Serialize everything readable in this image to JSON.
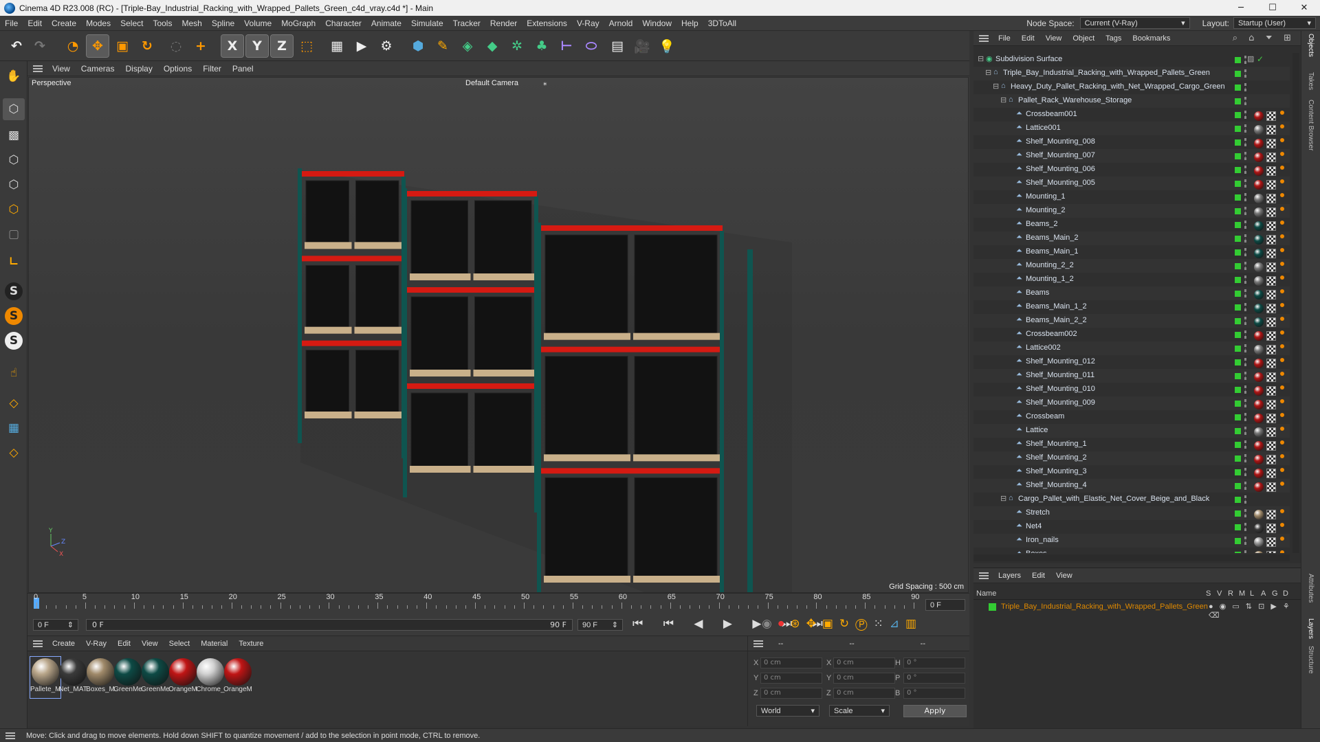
{
  "window": {
    "title": "Cinema 4D R23.008 (RC) - [Triple-Bay_Industrial_Racking_with_Wrapped_Pallets_Green_c4d_vray.c4d *] - Main",
    "min": "─",
    "max": "☐",
    "close": "✕"
  },
  "menu": [
    "File",
    "Edit",
    "Create",
    "Modes",
    "Select",
    "Tools",
    "Mesh",
    "Spline",
    "Volume",
    "MoGraph",
    "Character",
    "Animate",
    "Simulate",
    "Tracker",
    "Render",
    "Extensions",
    "V-Ray",
    "Arnold",
    "Window",
    "Help",
    "3DToAll"
  ],
  "nodespace": {
    "label": "Node Space:",
    "value": "Current (V-Ray)"
  },
  "layout": {
    "label": "Layout:",
    "value": "Startup (User)"
  },
  "toolbar_axes": [
    "X",
    "Y",
    "Z"
  ],
  "viewport": {
    "menu": [
      "View",
      "Cameras",
      "Display",
      "Options",
      "Filter",
      "Panel"
    ],
    "label": "Perspective",
    "camera": "Default Camera",
    "grid": "Grid Spacing : 500 cm",
    "axis_y": "Y",
    "axis_z": "Z",
    "axis_x": "X"
  },
  "timeline": {
    "ticks": [
      "0",
      "5",
      "10",
      "15",
      "20",
      "25",
      "30",
      "35",
      "40",
      "45",
      "50",
      "55",
      "60",
      "65",
      "70",
      "75",
      "80",
      "85",
      "90"
    ],
    "current": "0 F",
    "start": "0 F",
    "range_start": "0 F",
    "range_end": "90 F",
    "end": "90 F"
  },
  "materials": {
    "menu": [
      "Create",
      "V-Ray",
      "Edit",
      "View",
      "Select",
      "Material",
      "Texture"
    ],
    "items": [
      {
        "label": "Pallete_M",
        "color": "#b9a68a"
      },
      {
        "label": "Net_MAT",
        "color": "#3a3a3a"
      },
      {
        "label": "Boxes_M",
        "color": "#a08a6a"
      },
      {
        "label": "GreenMe",
        "color": "#0d4a45"
      },
      {
        "label": "GreenMe",
        "color": "#0d4a45"
      },
      {
        "label": "OrangeM",
        "color": "#c01515"
      },
      {
        "label": "Chrome_",
        "color": "#d0d0d0"
      },
      {
        "label": "OrangeM",
        "color": "#c01515"
      }
    ]
  },
  "coords": {
    "headers": [
      "--",
      "--",
      "--"
    ],
    "x": "X",
    "y": "Y",
    "z": "Z",
    "h": "H",
    "p": "P",
    "b": "B",
    "pos": "0 cm",
    "rot": "0 °",
    "world": "World",
    "scale": "Scale",
    "apply": "Apply"
  },
  "objects": {
    "menu": [
      "File",
      "Edit",
      "View",
      "Object",
      "Tags",
      "Bookmarks"
    ],
    "rows": [
      {
        "name": "Subdivision Surface",
        "depth": 0,
        "mat": ""
      },
      {
        "name": "Triple_Bay_Industrial_Racking_with_Wrapped_Pallets_Green",
        "depth": 1,
        "mat": ""
      },
      {
        "name": "Heavy_Duty_Pallet_Racking_with_Net_Wrapped_Cargo_Green",
        "depth": 2,
        "mat": ""
      },
      {
        "name": "Pallet_Rack_Warehouse_Storage",
        "depth": 3,
        "mat": ""
      },
      {
        "name": "Crossbeam001",
        "depth": 4,
        "mat": "#b01515"
      },
      {
        "name": "Lattice001",
        "depth": 4,
        "mat": "#777"
      },
      {
        "name": "Shelf_Mounting_008",
        "depth": 4,
        "mat": "#b01515"
      },
      {
        "name": "Shelf_Mounting_007",
        "depth": 4,
        "mat": "#b01515"
      },
      {
        "name": "Shelf_Mounting_006",
        "depth": 4,
        "mat": "#b01515"
      },
      {
        "name": "Shelf_Mounting_005",
        "depth": 4,
        "mat": "#b01515"
      },
      {
        "name": "Mounting_1",
        "depth": 4,
        "mat": "#777"
      },
      {
        "name": "Mounting_2",
        "depth": 4,
        "mat": "#777"
      },
      {
        "name": "Beams_2",
        "depth": 4,
        "mat": "#0d4a45"
      },
      {
        "name": "Beams_Main_2",
        "depth": 4,
        "mat": "#0d4a45"
      },
      {
        "name": "Beams_Main_1",
        "depth": 4,
        "mat": "#0d4a45"
      },
      {
        "name": "Mounting_2_2",
        "depth": 4,
        "mat": "#777"
      },
      {
        "name": "Mounting_1_2",
        "depth": 4,
        "mat": "#777"
      },
      {
        "name": "Beams",
        "depth": 4,
        "mat": "#0d4a45"
      },
      {
        "name": "Beams_Main_1_2",
        "depth": 4,
        "mat": "#0d4a45"
      },
      {
        "name": "Beams_Main_2_2",
        "depth": 4,
        "mat": "#0d4a45"
      },
      {
        "name": "Crossbeam002",
        "depth": 4,
        "mat": "#b01515"
      },
      {
        "name": "Lattice002",
        "depth": 4,
        "mat": "#777"
      },
      {
        "name": "Shelf_Mounting_012",
        "depth": 4,
        "mat": "#b01515"
      },
      {
        "name": "Shelf_Mounting_011",
        "depth": 4,
        "mat": "#b01515"
      },
      {
        "name": "Shelf_Mounting_010",
        "depth": 4,
        "mat": "#b01515"
      },
      {
        "name": "Shelf_Mounting_009",
        "depth": 4,
        "mat": "#b01515"
      },
      {
        "name": "Crossbeam",
        "depth": 4,
        "mat": "#b01515"
      },
      {
        "name": "Lattice",
        "depth": 4,
        "mat": "#777"
      },
      {
        "name": "Shelf_Mounting_1",
        "depth": 4,
        "mat": "#b01515"
      },
      {
        "name": "Shelf_Mounting_2",
        "depth": 4,
        "mat": "#b01515"
      },
      {
        "name": "Shelf_Mounting_3",
        "depth": 4,
        "mat": "#b01515"
      },
      {
        "name": "Shelf_Mounting_4",
        "depth": 4,
        "mat": "#b01515"
      },
      {
        "name": "Cargo_Pallet_with_Elastic_Net_Cover_Beige_and_Black",
        "depth": 3,
        "mat": ""
      },
      {
        "name": "Stretch",
        "depth": 4,
        "mat": "#a08a6a"
      },
      {
        "name": "Net4",
        "depth": 4,
        "mat": "#3a3a3a"
      },
      {
        "name": "Iron_nails",
        "depth": 4,
        "mat": "#999"
      },
      {
        "name": "Boxes",
        "depth": 4,
        "mat": "#a08a6a"
      }
    ]
  },
  "layers": {
    "menu": [
      "Layers",
      "Edit",
      "View"
    ],
    "name_header": "Name",
    "cols": [
      "S",
      "V",
      "R",
      "M",
      "L",
      "A",
      "G",
      "D"
    ],
    "item": "Triple_Bay_Industrial_Racking_with_Wrapped_Pallets_Green",
    "item_color": "#e08a00"
  },
  "side_tabs": [
    "Objects",
    "Takes",
    "Content Browser",
    "Attributes",
    "Layers",
    "Structure"
  ],
  "status": "Move: Click and drag to move elements. Hold down SHIFT to quantize movement / add to the selection in point mode, CTRL to remove."
}
